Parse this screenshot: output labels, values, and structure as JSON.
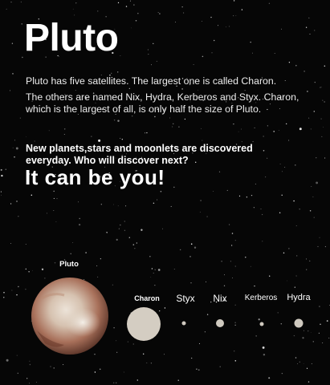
{
  "title": "Pluto",
  "paragraph_1": "Pluto has five satellites. The largest one is called Charon.",
  "paragraph_2": "The others are named Nix, Hydra, Kerberos and Styx. Charon, which is the largest of all, is only half the size of Pluto.",
  "callout": "New planets,stars and moonlets are discovered everyday. Who will discover next?",
  "slogan": "It can be you!",
  "bodies": {
    "pluto": "Pluto",
    "charon": "Charon",
    "styx": "Styx",
    "nix": "Nix",
    "kerberos": "Kerberos",
    "hydra": "Hydra"
  },
  "colors": {
    "background": "#060606",
    "text": "#ffffff",
    "moon": "#d8d1c6",
    "pluto_light": "#e6dcd0",
    "pluto_dark": "#8a4f3a"
  }
}
